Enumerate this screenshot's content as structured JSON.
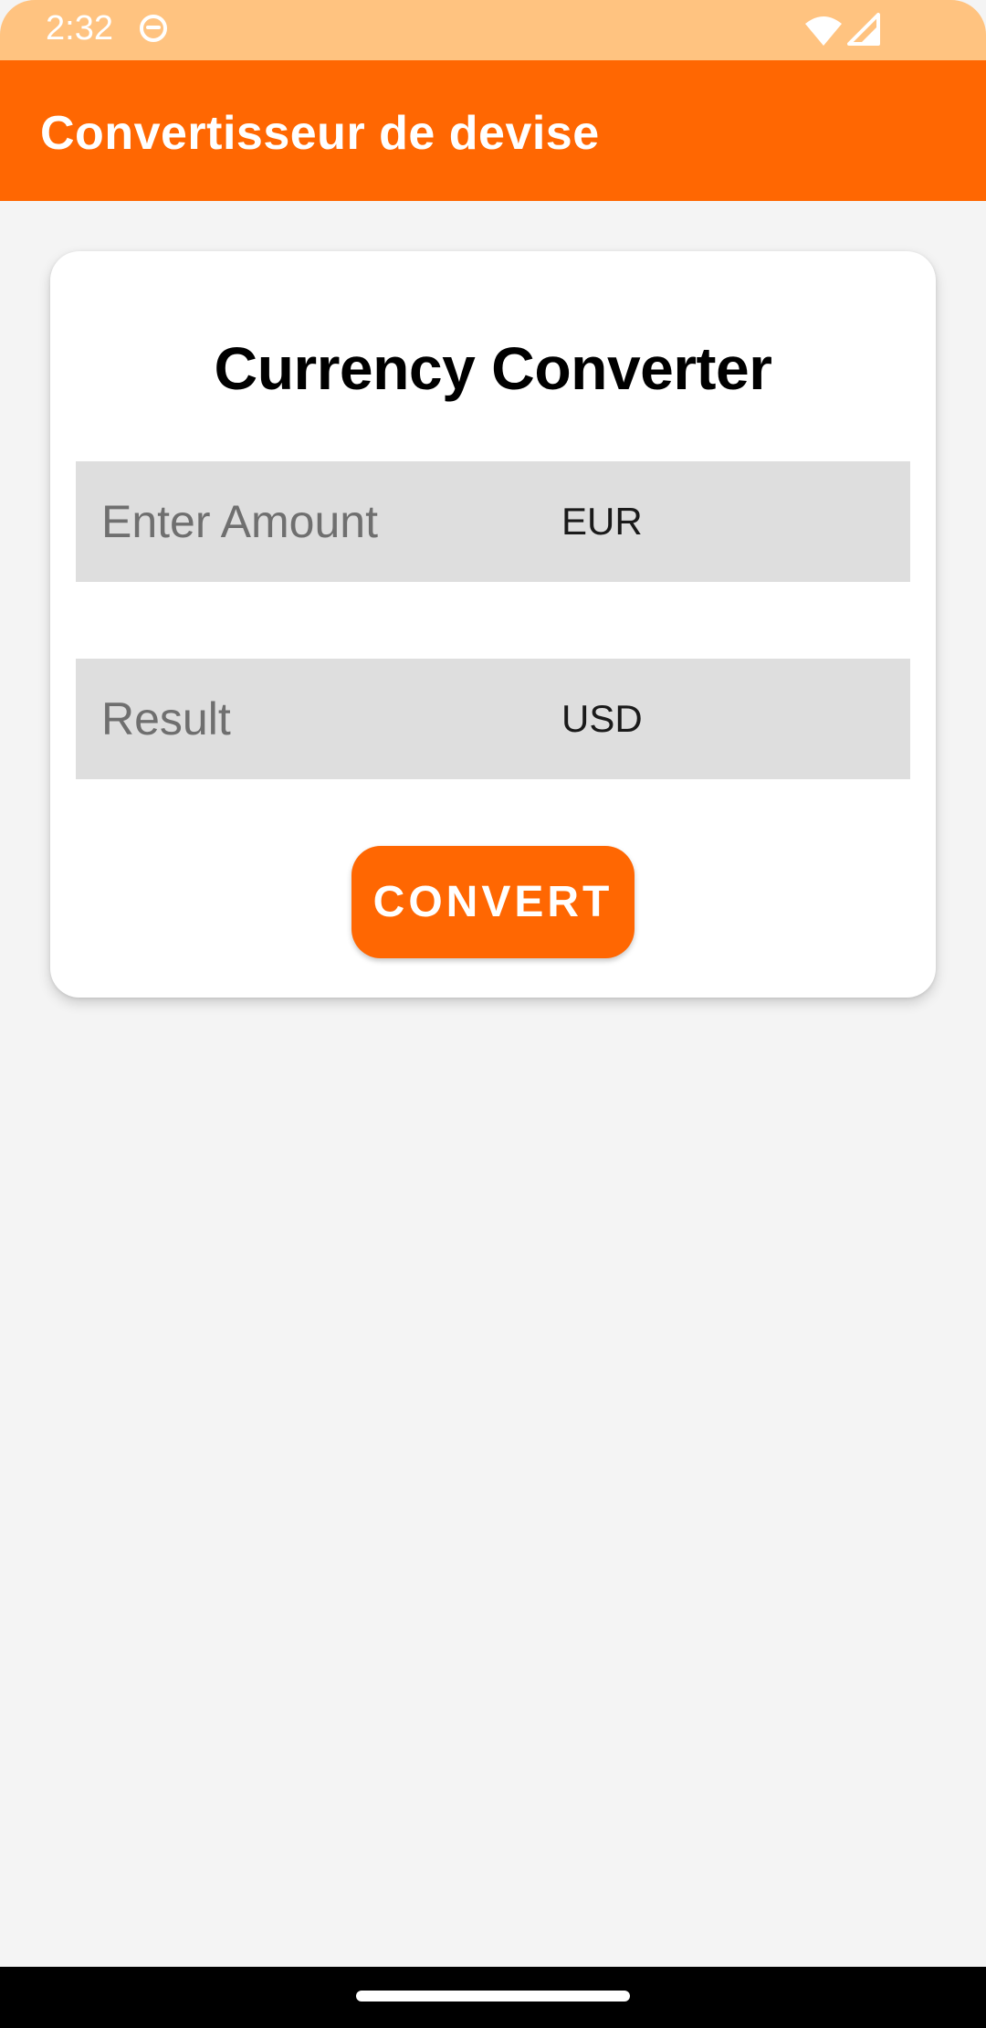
{
  "status_bar": {
    "time": "2:32",
    "icons": [
      "face-icon",
      "wifi-icon",
      "cellular-signal-icon"
    ]
  },
  "app_bar": {
    "title": "Convertisseur de devise",
    "color": "#ff6702"
  },
  "converter": {
    "heading": "Currency Converter",
    "amount_placeholder": "Enter Amount",
    "amount_value": "",
    "amount_currency": "EUR",
    "result_placeholder": "Result",
    "result_value": "",
    "result_currency": "USD",
    "convert_label": "CONVERT"
  },
  "colors": {
    "accent": "#ff6702",
    "status_bar": "#ffc380",
    "background": "#f4f4f4",
    "field": "#dedede"
  }
}
